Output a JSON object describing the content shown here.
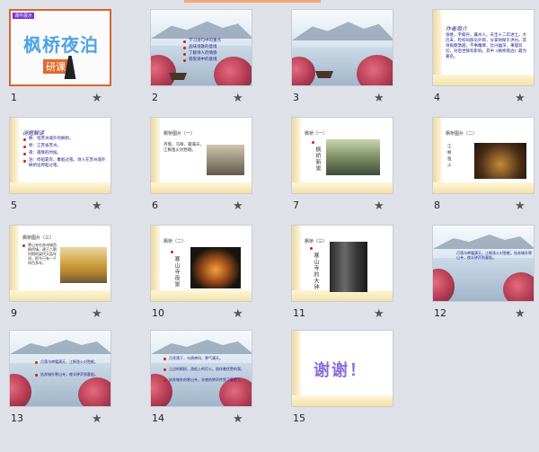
{
  "slides": [
    {
      "number": "1",
      "tag": "课件展示",
      "title": "枫桥夜泊",
      "footer": "研课"
    },
    {
      "number": "2",
      "bullets": [
        "学习诗句中的重点",
        "品味诗歌的意境",
        "了解诗人的情感",
        "感受诗中的意境"
      ]
    },
    {
      "number": "3"
    },
    {
      "number": "4",
      "heading": "作者简介",
      "body": "张继，字懿孙，襄州人。天宝十二年进士。大历末，检校祠部员外郎，分掌财赋于洪州。其诗爽朗激越，不事雕琢，比兴幽深，事理双切，对后世颇有影响。其中《枫桥夜泊》最为著名。"
    },
    {
      "number": "5",
      "heading": "诗题解读",
      "bullets": [
        "枫：指苏州城外的枫桥。",
        "桥：江苏省苏州。",
        "夜：夜晚的时候。",
        "泊：停船靠岸，乘船过夜。诗人在苏州城外枫桥边停船过夜。"
      ]
    },
    {
      "number": "6",
      "caption": "枫桥图片（一）",
      "text": "月落、乌啼、霜满天，江枫渔火对愁眠。"
    },
    {
      "number": "7",
      "caption": "枫桥（一）",
      "vertical": "枫桥新景"
    },
    {
      "number": "8",
      "caption": "枫桥图片（二）",
      "bullets": [
        "江",
        "枫",
        "渔",
        "火"
      ]
    },
    {
      "number": "9",
      "caption": "枫桥图片（三）",
      "text": "寒山寺在苏州城西枫桥镇，建于六朝时期的梁代天监年间，距今已有一千四百多年。"
    },
    {
      "number": "10",
      "caption": "枫桥（二）",
      "vertical": "寒山寺夜景"
    },
    {
      "number": "11",
      "caption": "枫桥（三）",
      "vertical": "寒山寺的大钟"
    },
    {
      "number": "12",
      "body": "月落乌啼霜满天，江枫渔火对愁眠。姑苏城外寒山寺，夜半钟声到客船。"
    },
    {
      "number": "13",
      "bullets": [
        "月落乌啼霜满天，江枫渔火对愁眠。",
        "姑苏城外寒山寺，夜半钟声到客船。"
      ]
    },
    {
      "number": "14",
      "bullets": [
        "月亮落下，乌鸦啼叫，寒气满天。",
        "江边的枫树，渔船上的灯火，陪伴着忧愁的我。",
        "姑苏城外的寒山寺，半夜的钟声传到了客船上。"
      ]
    },
    {
      "number": "15",
      "text": "谢谢！"
    }
  ],
  "icons": {
    "star": "★"
  },
  "colors": {
    "selection": "#d9642f",
    "text": "#1a1a8a",
    "thanks": "#8a6fd8"
  }
}
